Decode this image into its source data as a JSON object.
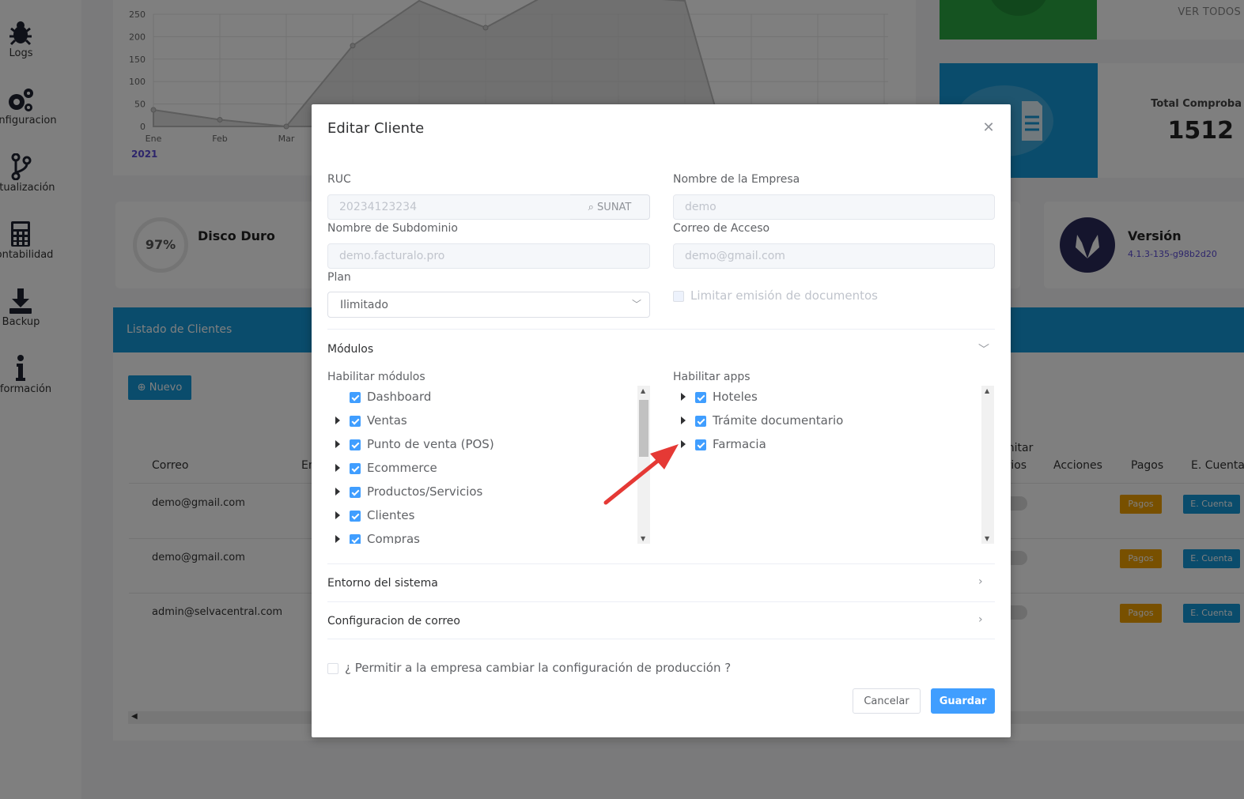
{
  "sidebar": {
    "items": [
      {
        "label": "Logs",
        "icon": "bug-icon"
      },
      {
        "label": "Configuracion",
        "icon": "gears-icon"
      },
      {
        "label": "Actualización",
        "icon": "git-branch-icon"
      },
      {
        "label": "Contabilidad",
        "icon": "calculator-icon"
      },
      {
        "label": "Backup",
        "icon": "download-icon"
      },
      {
        "label": "Información",
        "icon": "info-icon"
      }
    ]
  },
  "chart_data": {
    "type": "area",
    "categories": [
      "Ene",
      "Feb",
      "Mar"
    ],
    "y_ticks": [
      "250",
      "200",
      "150",
      "100",
      "50",
      "0"
    ],
    "series": [
      {
        "values": [
          37,
          15,
          0
        ]
      }
    ],
    "year": "2021"
  },
  "stats": {
    "ver_todos": "VER TODOS",
    "total_label": "Total Comproba",
    "total_value": "1512",
    "disk_percent": "97%",
    "disk_title": "Disco Duro",
    "version_title": "Versión",
    "version_number": "4.1.3-135-g98b2d20"
  },
  "list": {
    "title": "Listado de Clientes",
    "new_button": "Nuevo",
    "headers": {
      "correo": "Correo",
      "limitar": "mitar",
      "limitar2": "arios",
      "acciones": "Acciones",
      "pagos": "Pagos",
      "ecuenta": "E. Cuenta",
      "em": "Em"
    },
    "rows": [
      {
        "email": "demo@gmail.com"
      },
      {
        "email": "demo@gmail.com"
      },
      {
        "email": "admin@selvacentral.com"
      }
    ],
    "pagos_label": "Pagos",
    "ecuenta_label": "E. Cuenta"
  },
  "modal": {
    "title": "Editar Cliente",
    "ruc_label": "RUC",
    "ruc_value": "20234123234",
    "sunat_button": "SUNAT",
    "empresa_label": "Nombre de la Empresa",
    "empresa_value": "demo",
    "subdominio_label": "Nombre de Subdominio",
    "subdominio_value": "demo.facturalo.pro",
    "correo_label": "Correo de Acceso",
    "correo_value": "demo@gmail.com",
    "plan_label": "Plan",
    "plan_value": "Ilimitado",
    "limitar_label": "Limitar emisión de documentos",
    "modulos_title": "Módulos",
    "habilitar_modulos_label": "Habilitar módulos",
    "modulos": [
      {
        "label": "Dashboard",
        "expandable": false
      },
      {
        "label": "Ventas",
        "expandable": true
      },
      {
        "label": "Punto de venta (POS)",
        "expandable": true
      },
      {
        "label": "Ecommerce",
        "expandable": true
      },
      {
        "label": "Productos/Servicios",
        "expandable": true
      },
      {
        "label": "Clientes",
        "expandable": true
      },
      {
        "label": "Compras",
        "expandable": true
      }
    ],
    "habilitar_apps_label": "Habilitar apps",
    "apps": [
      {
        "label": "Hoteles"
      },
      {
        "label": "Trámite documentario"
      },
      {
        "label": "Farmacia"
      }
    ],
    "entorno_title": "Entorno del sistema",
    "config_correo_title": "Configuracion de correo",
    "permitir_label": "¿ Permitir a la empresa cambiar la configuración de producción ?",
    "cancel_button": "Cancelar",
    "save_button": "Guardar"
  },
  "colors": {
    "primary": "#409eff",
    "header_blue": "#1499d8",
    "green_card": "#2aa742",
    "pagos_orange": "#f0a000",
    "annotation_red": "#e53935"
  }
}
